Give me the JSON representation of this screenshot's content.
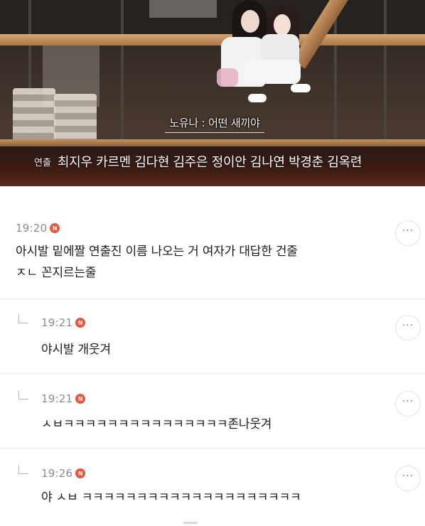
{
  "video": {
    "subtitle": "노유나 : 어떤 새끼야",
    "credits_role": "연출",
    "credits_names": "최지우 카르멘 김다현 김주은 정이안 김나연 박경춘 김옥련"
  },
  "comments": [
    {
      "time": "19:20",
      "badge": "N",
      "text_line1": "아시발 밑에짤 연출진 이름 나오는 거 여자가 대답한 건줄",
      "text_line2": "ㅈㄴ 꼰지르는줄",
      "more": "···"
    },
    {
      "time": "19:21",
      "badge": "N",
      "text_line1": "야시발 개웃겨",
      "more": "···"
    },
    {
      "time": "19:21",
      "badge": "N",
      "text_line1": "ㅅㅂㅋㅋㅋㅋㅋㅋㅋㅋㅋㅋㅋㅋㅋㅋㅋ존나웃겨",
      "more": "···"
    },
    {
      "time": "19:26",
      "badge": "N",
      "text_line1": "야 ㅅㅂ ㅋㅋㅋㅋㅋㅋㅋㅋㅋㅋㅋㅋㅋㅋㅋㅋㅋㅋㅋㅋ",
      "more": "···"
    }
  ],
  "colors": {
    "badge": "#e8563f",
    "time": "#8c8c8c",
    "divider": "#ececec"
  },
  "icons": {
    "reply": "reply-arrow-icon",
    "more": "more-options-icon",
    "new": "new-badge-icon"
  }
}
